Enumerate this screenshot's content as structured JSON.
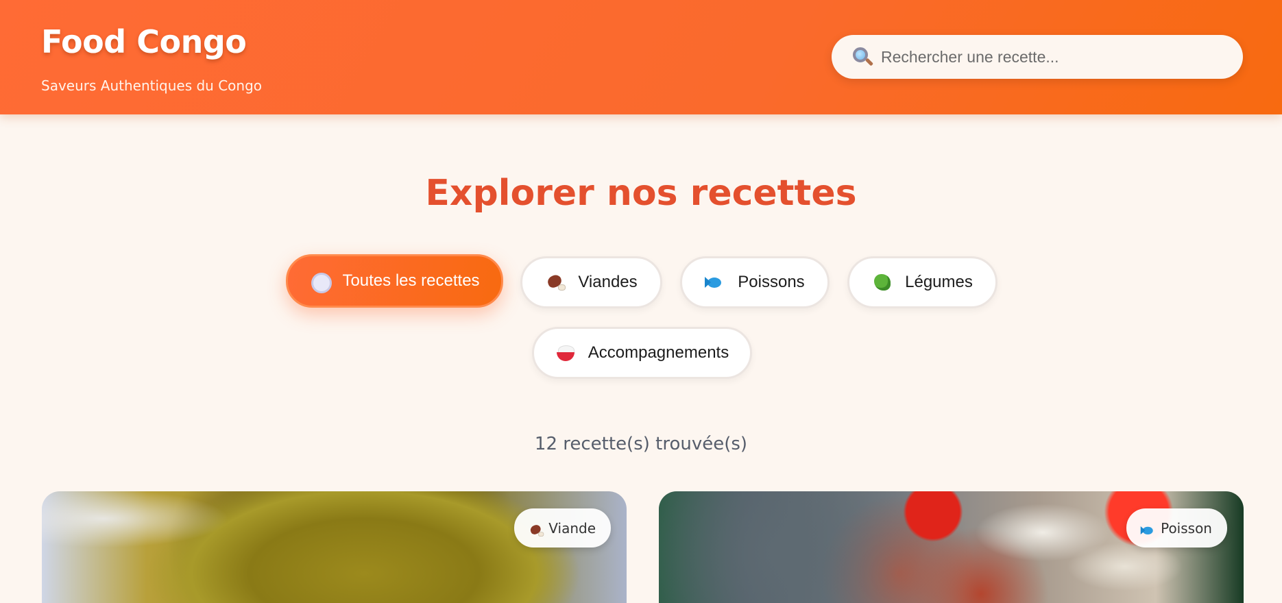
{
  "header": {
    "brand_title": "Food Congo",
    "brand_subtitle": "Saveurs Authentiques du Congo",
    "search": {
      "placeholder": "Rechercher une recette...",
      "value": "",
      "icon": "search-icon"
    }
  },
  "main": {
    "section_title": "Explorer nos recettes",
    "filters": [
      {
        "label": "Toutes les recettes",
        "icon": "plate-icon",
        "active": true
      },
      {
        "label": "Viandes",
        "icon": "meat-icon",
        "active": false
      },
      {
        "label": "Poissons",
        "icon": "fish-icon",
        "active": false
      },
      {
        "label": "Légumes",
        "icon": "vegetable-icon",
        "active": false
      },
      {
        "label": "Accompagnements",
        "icon": "rice-icon",
        "active": false
      }
    ],
    "result_count": "12 recette(s) trouvée(s)",
    "recipes": [
      {
        "badge": "Viande",
        "badge_icon": "meat-icon"
      },
      {
        "badge": "Poisson",
        "badge_icon": "fish-icon"
      }
    ]
  },
  "colors": {
    "accent": "#ff6b35",
    "accent_dark": "#f86a10",
    "title": "#e4502e",
    "background": "#fdf6f0"
  }
}
